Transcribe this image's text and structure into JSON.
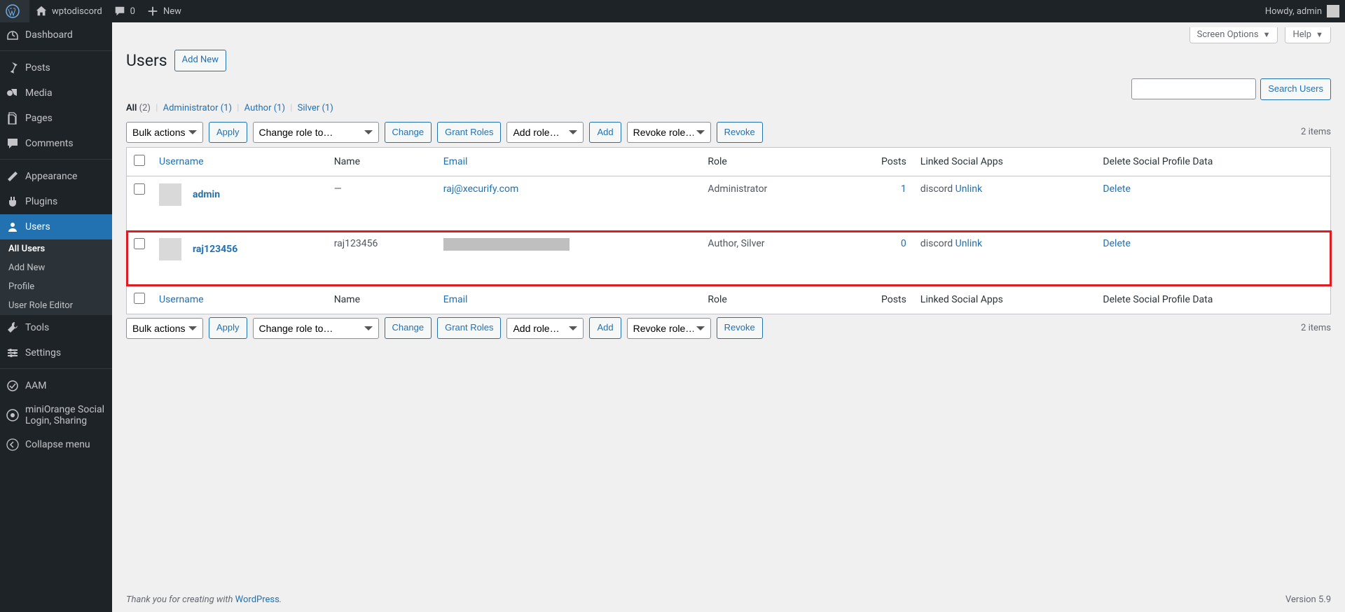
{
  "toolbar": {
    "site_name": "wptodiscord",
    "comments_count": "0",
    "new_label": "New",
    "howdy": "Howdy, admin"
  },
  "sidebar": {
    "items": [
      {
        "icon": "dashboard",
        "label": "Dashboard"
      },
      {
        "icon": "pin",
        "label": "Posts"
      },
      {
        "icon": "media",
        "label": "Media"
      },
      {
        "icon": "page",
        "label": "Pages"
      },
      {
        "icon": "comment",
        "label": "Comments"
      },
      {
        "icon": "appearance",
        "label": "Appearance"
      },
      {
        "icon": "plugin",
        "label": "Plugins"
      },
      {
        "icon": "users",
        "label": "Users",
        "current": true
      },
      {
        "icon": "tools",
        "label": "Tools"
      },
      {
        "icon": "settings",
        "label": "Settings"
      },
      {
        "icon": "aam",
        "label": "AAM"
      },
      {
        "icon": "miniorange",
        "label": "miniOrange Social Login, Sharing"
      },
      {
        "icon": "collapse",
        "label": "Collapse menu"
      }
    ],
    "submenu": [
      {
        "label": "All Users",
        "current": true
      },
      {
        "label": "Add New"
      },
      {
        "label": "Profile"
      },
      {
        "label": "User Role Editor"
      }
    ]
  },
  "screen_meta": {
    "screen_options": "Screen Options",
    "help": "Help"
  },
  "page": {
    "title": "Users",
    "add_new": "Add New"
  },
  "filters": {
    "all_label": "All",
    "all_count": "(2)",
    "admin_label": "Administrator",
    "admin_count": "(1)",
    "author_label": "Author",
    "author_count": "(1)",
    "silver_label": "Silver",
    "silver_count": "(1)"
  },
  "actions": {
    "bulk_placeholder": "Bulk actions",
    "apply": "Apply",
    "change_role": "Change role to…",
    "change": "Change",
    "grant_roles": "Grant Roles",
    "add_role": "Add role…",
    "add": "Add",
    "revoke_role": "Revoke role…",
    "revoke": "Revoke",
    "items_count": "2 items",
    "search_btn": "Search Users"
  },
  "columns": {
    "username": "Username",
    "name": "Name",
    "email": "Email",
    "role": "Role",
    "posts": "Posts",
    "linked": "Linked Social Apps",
    "delete_social": "Delete Social Profile Data"
  },
  "rows": [
    {
      "username": "admin",
      "name": "—",
      "email": "raj@xecurify.com",
      "role": "Administrator",
      "posts": "1",
      "app": "discord",
      "unlink": "Unlink",
      "delete": "Delete",
      "redacted": false
    },
    {
      "username": "raj123456",
      "name": "raj123456",
      "email": "",
      "role": "Author, Silver",
      "posts": "0",
      "app": "discord",
      "unlink": "Unlink",
      "delete": "Delete",
      "redacted": true,
      "highlight": true
    }
  ],
  "footer": {
    "thanks_prefix": "Thank you for creating with ",
    "wp": "WordPress",
    "version": "Version 5.9"
  }
}
